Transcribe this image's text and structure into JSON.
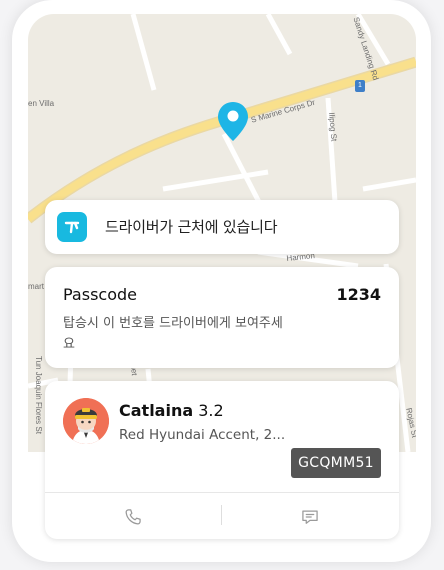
{
  "map": {
    "labels": {
      "sandy_landing_rd": "Sandy Landing Rd",
      "glen_villa": "en Villa",
      "marine_corps_dr": "S Marine Corps Dr",
      "route_badge": "1",
      "ilipog_st": "Ilipog St",
      "harmon": "Harmon",
      "mart": "mart C",
      "tun_joaquin": "Tun Joaquin Flores St",
      "rojas_st": "Rojas St",
      "partial_street": "uet"
    },
    "colors": {
      "land": "#eeebe3",
      "road": "#ffffff",
      "highway": "#f8dc86",
      "pin": "#1eb5e6"
    }
  },
  "status": {
    "icon": "taxi-logo-icon",
    "message": "드라이버가 근처에 있습니다"
  },
  "passcode": {
    "label": "Passcode",
    "value": "1234",
    "note": "탑승시 이 번호를 드라이버에게 보여주세요"
  },
  "driver": {
    "name": "Catlaina",
    "rating": "3.2",
    "car": "Red Hyundai Accent, 2...",
    "plate": "GCQMM51",
    "avatar_icon": "driver-avatar-icon"
  },
  "actions": {
    "call_icon": "phone-icon",
    "chat_icon": "chat-icon"
  }
}
